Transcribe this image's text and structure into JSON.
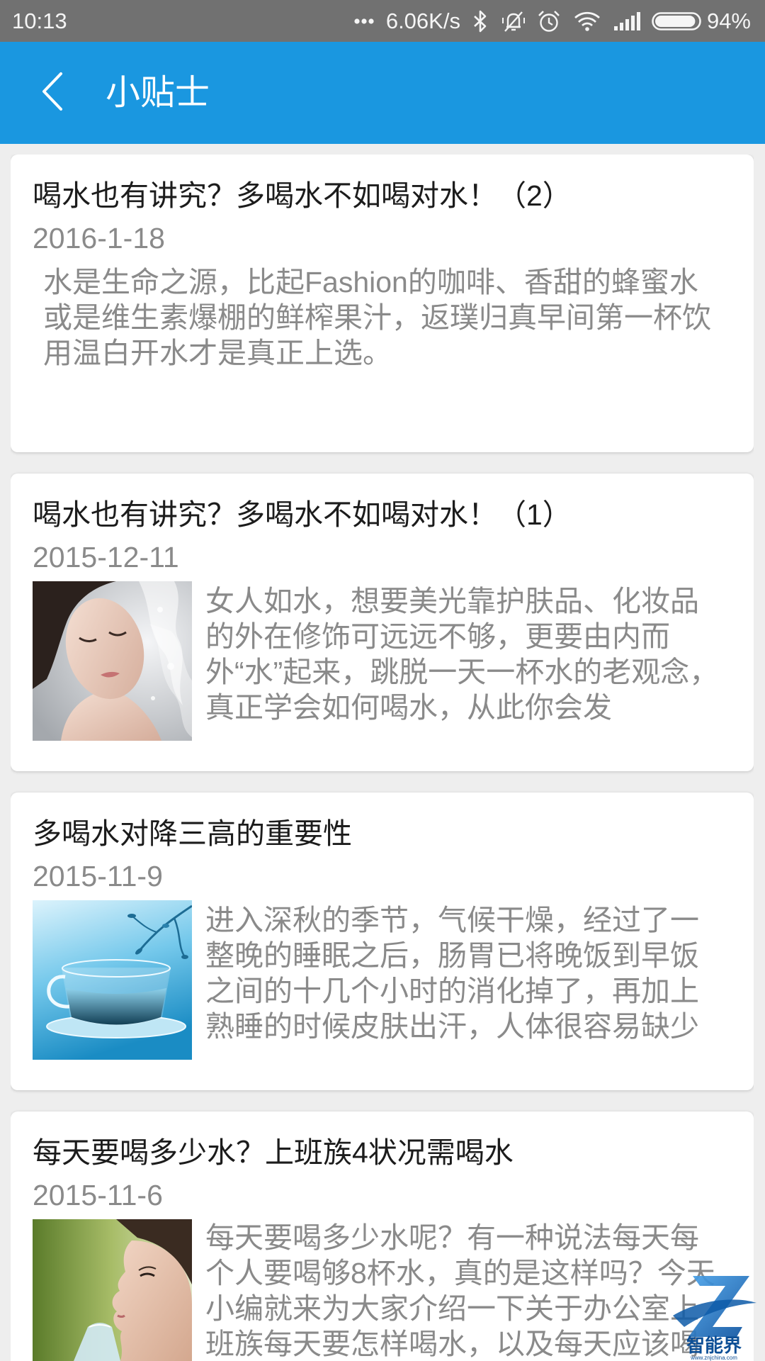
{
  "status_bar": {
    "time": "10:13",
    "net_speed": "6.06K/s",
    "battery": "94%",
    "icons": [
      "more-dots-icon",
      "bluetooth-icon",
      "silent-mode-icon",
      "alarm-icon",
      "wifi-icon",
      "signal-icon",
      "battery-icon"
    ]
  },
  "app_bar": {
    "back_icon": "back-arrow-icon",
    "title": "小贴士"
  },
  "colors": {
    "status_bar": "#717171",
    "app_bar": "#1a97e0",
    "page_background": "#eeeeee",
    "card_background": "#ffffff",
    "title_text": "#1c1c1c",
    "secondary_text": "#8a8a8a"
  },
  "cards": [
    {
      "title": "喝水也有讲究？多喝水不如喝对水！（2）",
      "date": "2016-1-18",
      "lines": [
        "水是生命之源，比起Fashion的咖啡、香甜的蜂蜜水",
        "或是维生素爆棚的鲜榨果汁，返璞归真早间第一杯饮",
        "用温白开水才是真正上选。"
      ]
    },
    {
      "title": "喝水也有讲究？多喝水不如喝对水！（1）",
      "date": "2015-12-11",
      "lines": [
        "女人如水，想要美光靠护肤品、化妆品",
        "的外在修饰可远远不够，更要由内而",
        "外“水”起来，跳脱一天一杯水的老观念，",
        "真正学会如何喝水，从此你会发"
      ]
    },
    {
      "title": "多喝水对降三高的重要性",
      "date": "2015-11-9",
      "lines": [
        "进入深秋的季节，气候干燥，经过了一",
        "整晚的睡眠之后，肠胃已将晚饭到早饭",
        "之间的十几个小时的消化掉了，再加上",
        "熟睡的时候皮肤出汗，人体很容易缺少"
      ]
    },
    {
      "title": "每天要喝多少水？上班族4状况需喝水",
      "date": "2015-11-6",
      "lines": [
        "每天要喝多少水呢？有一种说法每天每",
        "个人要喝够8杯水，真的是这样吗？今天",
        "小编就来为大家介绍一下关于办公室上",
        "班族每天要怎样喝水，以及每天应该喝"
      ]
    }
  ],
  "watermark": {
    "brand": "智能界",
    "url": "www.znjchina.com"
  }
}
